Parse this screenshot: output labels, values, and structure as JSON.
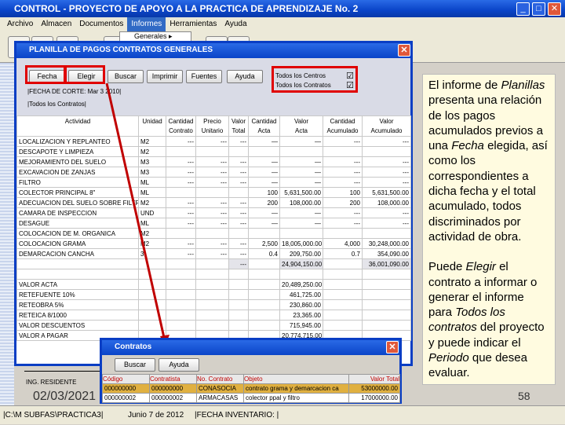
{
  "app": {
    "title": "CONTROL - PROYECTO DE APOYO A LA PRACTICA DE APRENDIZAJE No. 2",
    "menu": [
      "Archivo",
      "Almacen",
      "Documentos",
      "Informes",
      "Herramientas",
      "Ayuda"
    ],
    "submenu_item": "Generales"
  },
  "planilla": {
    "title": "PLANILLA DE PAGOS CONTRATOS GENERALES",
    "buttons": [
      "Fecha",
      "Elegir",
      "Buscar",
      "Imprimir",
      "Fuentes",
      "Ayuda"
    ],
    "checks": [
      {
        "label": "Todos los Centros",
        "checked": true
      },
      {
        "label": "Todos los Contratos",
        "checked": true
      }
    ],
    "fecha_corte": "|FECHA DE CORTE: Mar 3 2010|",
    "contratos_label": "|Todos los Contratos|",
    "columns": [
      [
        "Actividad",
        ""
      ],
      [
        "Unidad",
        ""
      ],
      [
        "Cantidad",
        "Contrato"
      ],
      [
        "Precio",
        "Unitario"
      ],
      [
        "Valor",
        "Total"
      ],
      [
        "Cantidad",
        "Acta"
      ],
      [
        "Valor",
        "Acta"
      ],
      [
        "Cantidad",
        "Acumulado"
      ],
      [
        "Valor",
        "Acumulado"
      ]
    ],
    "rows": [
      [
        "LOCALIZACION Y REPLANTEO",
        "M2",
        "---",
        "---",
        "---",
        "—",
        "—",
        "---",
        "---"
      ],
      [
        "DESCAPOTE Y LIMPIEZA",
        "M2",
        "",
        "",
        "",
        "",
        "",
        "",
        ""
      ],
      [
        "MEJORAMIENTO DEL SUELO",
        "M3",
        "---",
        "---",
        "---",
        "—",
        "—",
        "---",
        "---"
      ],
      [
        "EXCAVACION DE ZANJAS",
        "M3",
        "---",
        "---",
        "---",
        "—",
        "—",
        "---",
        "---"
      ],
      [
        "FILTRO",
        "ML",
        "---",
        "---",
        "---",
        "—",
        "—",
        "---",
        "---"
      ],
      [
        "COLECTOR PRINCIPAL 8\"",
        "ML",
        "",
        "",
        "",
        "100",
        "5,631,500.00",
        "100",
        "5,631,500.00"
      ],
      [
        "ADECUACION DEL SUELO SOBRE FILTRO",
        "M2",
        "---",
        "---",
        "---",
        "200",
        "108,000.00",
        "200",
        "108,000.00"
      ],
      [
        "CAMARA DE INSPECCION",
        "UND",
        "---",
        "---",
        "---",
        "—",
        "—",
        "---",
        "---"
      ],
      [
        "DESAGUE",
        "ML",
        "---",
        "---",
        "---",
        "—",
        "—",
        "---",
        "---"
      ],
      [
        "COLOCACION DE M. ORGANICA",
        "M2",
        "",
        "",
        "",
        "",
        "",
        "",
        ""
      ],
      [
        "COLOCACION GRAMA",
        "M2",
        "---",
        "---",
        "---",
        "2,500",
        "18,005,000.00",
        "4,000",
        "30,248,000.00"
      ],
      [
        "DEMARCACION CANCHA",
        "3",
        "---",
        "---",
        "---",
        "0.4",
        "209,750.00",
        "0.7",
        "354,090.00"
      ]
    ],
    "total_row": [
      "",
      "",
      "",
      "",
      "---",
      "",
      "24,904,150.00",
      "",
      "36,001,090.00"
    ],
    "summary": [
      [
        "VALOR ACTA",
        "20,489,250.00"
      ],
      [
        "RETEFUENTE 10%",
        "461,725.00"
      ],
      [
        "RETEOBRA 5%",
        "230,860.00"
      ],
      [
        "RETEICA 8/1000",
        "23,365.00"
      ],
      [
        "VALOR DESCUENTOS",
        "715,945.00"
      ],
      [
        "VALOR A PAGAR",
        "20,774,715.00"
      ]
    ],
    "signature": "ING. RESIDENTE"
  },
  "contratos": {
    "title": "Contratos",
    "buttons": [
      "Buscar",
      "Ayuda"
    ],
    "columns": [
      "Código",
      "Contratista",
      "No. Contrato",
      "Objeto",
      "Valor Total"
    ],
    "rows": [
      [
        "000000000",
        "000000000",
        "CONASOCIA",
        "contrato grama y demarcacion ca",
        "53000000.00"
      ],
      [
        "000000002",
        "000000002",
        "ARMACASAS",
        "colector ppal y filtro",
        "17000000.00"
      ]
    ]
  },
  "slide": {
    "date": "02/03/2021",
    "page": "58",
    "note_p1": [
      "El informe de ",
      {
        "i": "Planillas"
      },
      " presenta una relación de los pagos acumulados previos a una ",
      {
        "i": "Fecha"
      },
      " elegida, así como los correspondientes a dicha fecha y el total acumulado, todos discriminados por actividad de obra."
    ],
    "note_p2": [
      "Puede ",
      {
        "i": "Elegir"
      },
      " el contrato a informar o generar el informe para ",
      {
        "i": "Todos los contratos"
      },
      " del proyecto y puede indicar el ",
      {
        "i": "Periodo"
      },
      " que desea evaluar."
    ]
  },
  "status": {
    "path": "|C:\\M SUBFAS\\PRACTICA3|",
    "date": "Junio 7 de 2012",
    "inventario": "|FECHA INVENTARIO: |"
  },
  "colors": {
    "highlight": "#e00000",
    "selected_row": "#e0b040",
    "titlebar": "#0a44c8"
  }
}
